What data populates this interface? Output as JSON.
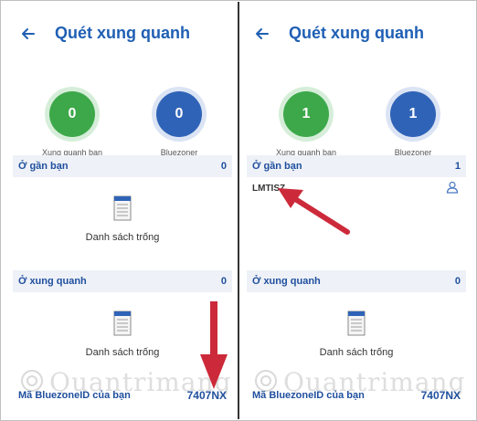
{
  "colors": {
    "accent": "#1f5fb4",
    "green": "#3da84a",
    "blue": "#2f63b7",
    "arrow": "#cc2a3a",
    "section_bg": "#eef1f7"
  },
  "watermark": "Quantrimang",
  "left": {
    "title": "Quét xung quanh",
    "back_icon": "arrow-left-icon",
    "circles": {
      "near_count": "0",
      "near_label": "Xung quanh bạn",
      "bluezoner_count": "0",
      "bluezoner_label": "Bluezoner"
    },
    "near_section": {
      "title": "Ở gần bạn",
      "count": "0"
    },
    "near_empty_text": "Danh sách trống",
    "around_section": {
      "title": "Ở xung quanh",
      "count": "0"
    },
    "around_empty_text": "Danh sách trống",
    "footer": {
      "label": "Mã BluezoneID của bạn",
      "value": "7407NX"
    }
  },
  "right": {
    "title": "Quét xung quanh",
    "back_icon": "arrow-left-icon",
    "circles": {
      "near_count": "1",
      "near_label": "Xung quanh bạn",
      "bluezoner_count": "1",
      "bluezoner_label": "Bluezoner"
    },
    "near_section": {
      "title": "Ở gần bạn",
      "count": "1"
    },
    "device": {
      "name": "LMTISZ",
      "icon": "user-icon"
    },
    "around_section": {
      "title": "Ở xung quanh",
      "count": "0"
    },
    "around_empty_text": "Danh sách trống",
    "footer": {
      "label": "Mã BluezoneID của bạn",
      "value": "7407NX"
    }
  }
}
